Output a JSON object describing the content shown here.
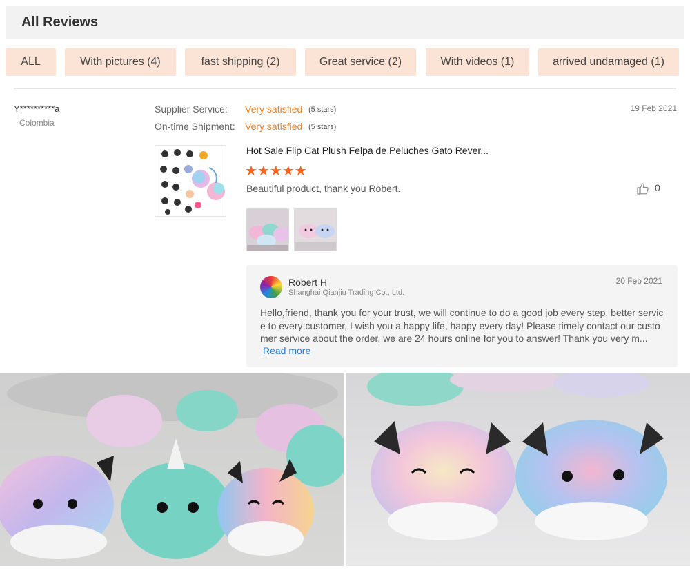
{
  "header": {
    "title": "All Reviews"
  },
  "filters": [
    "ALL",
    "With pictures (4)",
    "fast shipping (2)",
    "Great service (2)",
    "With videos (1)",
    "arrived undamaged (1)"
  ],
  "review": {
    "reviewer": "Y**********a",
    "country": "Colombia",
    "date": "19 Feb 2021",
    "ratings": [
      {
        "label": "Supplier Service:",
        "value": "Very satisfied",
        "stars": "(5 stars)"
      },
      {
        "label": "On-time Shipment:",
        "value": "Very satisfied",
        "stars": "(5 stars)"
      }
    ],
    "product_title": "Hot Sale Flip Cat Plush Felpa de Peluches Gato Rever...",
    "stars_glyphs": "★★★★★",
    "star_rating": 5,
    "text": "Beautiful product, thank you Robert.",
    "likes": "0"
  },
  "reply": {
    "name": "Robert H",
    "company": "Shanghai Qianjiu Trading Co., Ltd.",
    "date": "20 Feb 2021",
    "text": "Hello,friend, thank you for your trust, we will continue to do a good job every step, better service to every customer, I wish you a happy life, happy every day! Please timely contact our customer service about the order, we are 24 hours online for you to answer! Thank you very m...",
    "read_more": "Read more"
  },
  "colors": {
    "chip_bg": "#fbe3d6",
    "accent_orange": "#f47d22",
    "star": "#f4641e",
    "link": "#2b7bd6"
  }
}
